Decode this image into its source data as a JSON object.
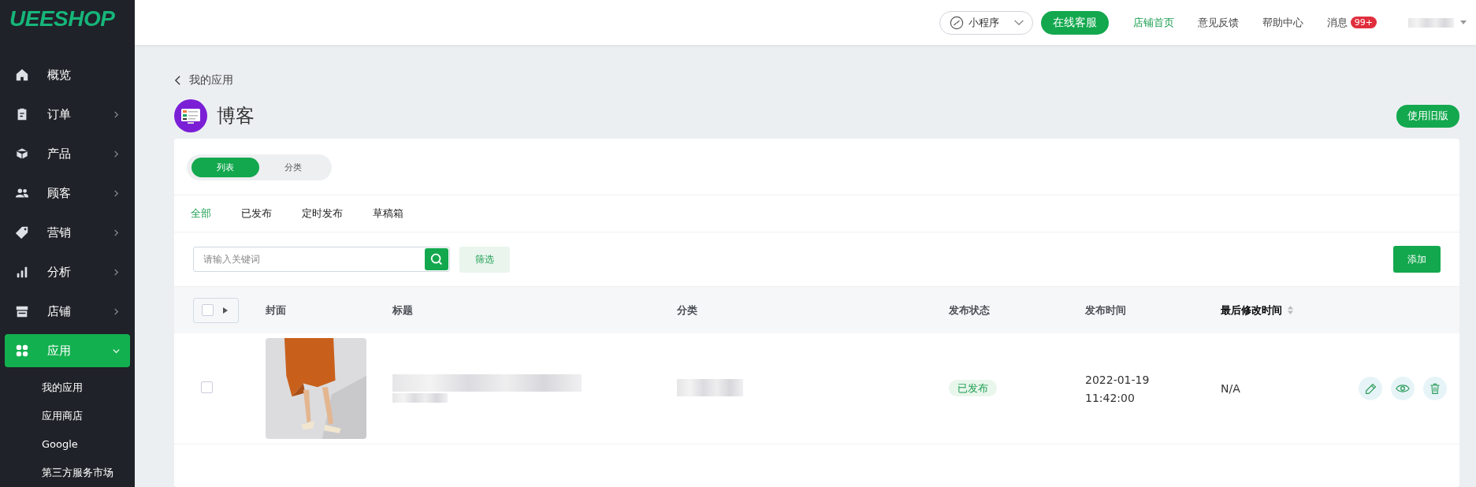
{
  "logo": "UEESHOP",
  "sidebar": {
    "items": [
      {
        "label": "概览",
        "kind": "link",
        "selected": false
      },
      {
        "label": "订单",
        "kind": "menu",
        "selected": false,
        "expanded": false
      },
      {
        "label": "产品",
        "kind": "menu",
        "selected": false,
        "expanded": false
      },
      {
        "label": "顾客",
        "kind": "menu",
        "selected": false,
        "expanded": false
      },
      {
        "label": "营销",
        "kind": "menu",
        "selected": false,
        "expanded": false
      },
      {
        "label": "分析",
        "kind": "menu",
        "selected": false,
        "expanded": false
      },
      {
        "label": "店铺",
        "kind": "menu",
        "selected": false,
        "expanded": false
      },
      {
        "label": "应用",
        "kind": "menu",
        "selected": true,
        "expanded": true,
        "children": [
          {
            "label": "我的应用"
          },
          {
            "label": "应用商店"
          },
          {
            "label": "Google"
          },
          {
            "label": "第三方服务市场"
          }
        ]
      }
    ]
  },
  "topbar": {
    "mini_program": "小程序",
    "service_button": "在线客服",
    "links": [
      {
        "label": "店铺首页",
        "selected": true
      },
      {
        "label": "意见反馈",
        "selected": false
      },
      {
        "label": "帮助中心",
        "selected": false
      }
    ],
    "messages": {
      "label": "消息",
      "badge": "99+"
    }
  },
  "page": {
    "back_link": "我的应用",
    "title": "博客",
    "old_version_button": "使用旧版"
  },
  "view_switch": [
    {
      "label": "列表",
      "selected": true
    },
    {
      "label": "分类",
      "selected": false
    }
  ],
  "status_tabs": [
    {
      "label": "全部",
      "selected": true
    },
    {
      "label": "已发布",
      "selected": false
    },
    {
      "label": "定时发布",
      "selected": false
    },
    {
      "label": "草稿箱",
      "selected": false
    }
  ],
  "search": {
    "placeholder": "请输入关键词"
  },
  "filter_button": "筛选",
  "add_button": "添加",
  "table": {
    "columns": [
      {
        "label": "封面",
        "sortable": false
      },
      {
        "label": "标题",
        "sortable": false
      },
      {
        "label": "分类",
        "sortable": false
      },
      {
        "label": "发布状态",
        "sortable": false
      },
      {
        "label": "发布时间",
        "sortable": false
      },
      {
        "label": "最后修改时间",
        "sortable": true
      }
    ],
    "rows": [
      {
        "checked": false,
        "status": "已发布",
        "publish_date": "2022-01-19",
        "publish_time": "11:42:00",
        "modified": "N/A"
      }
    ]
  }
}
